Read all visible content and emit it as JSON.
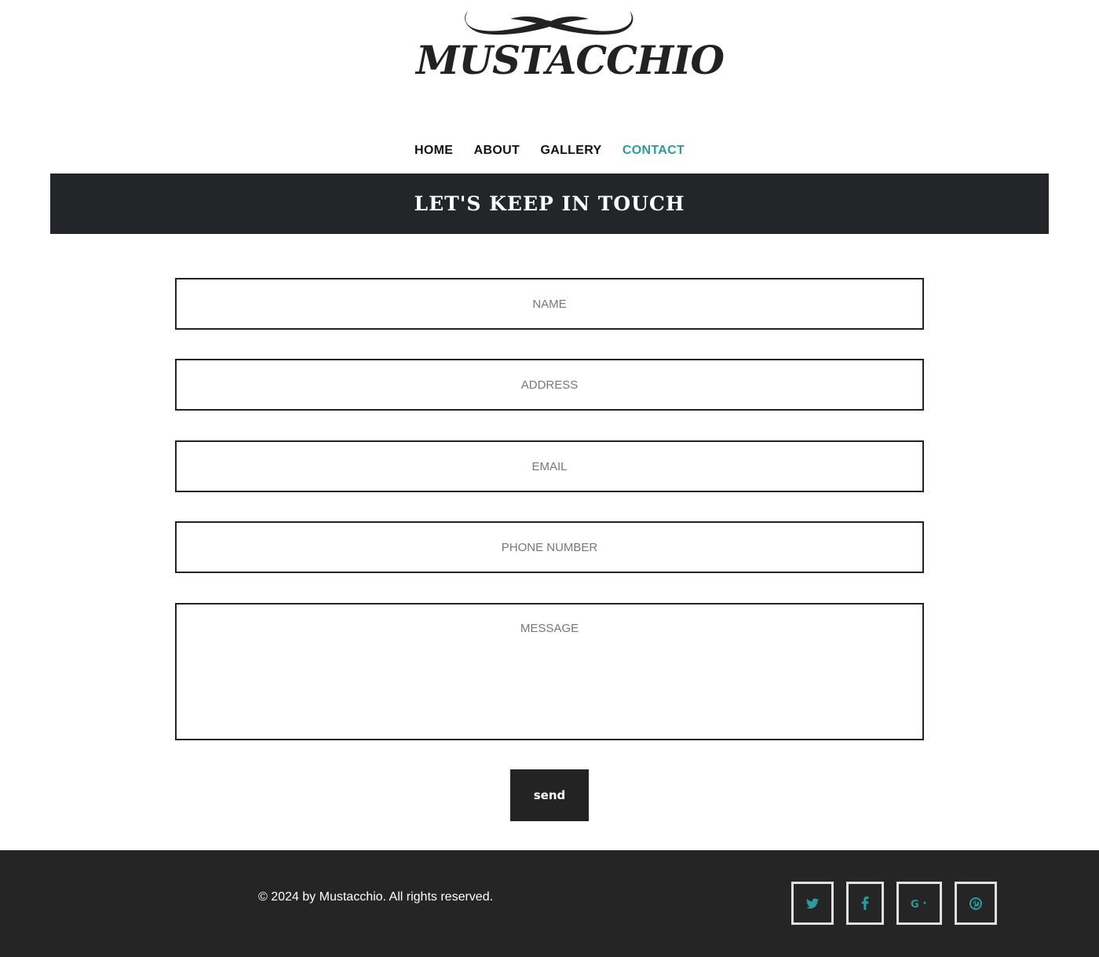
{
  "logo": {
    "text": "MUSTACCHIO"
  },
  "nav": {
    "items": [
      {
        "label": "HOME"
      },
      {
        "label": "ABOUT"
      },
      {
        "label": "GALLERY"
      },
      {
        "label": "CONTACT"
      }
    ],
    "active": "CONTACT"
  },
  "banner": {
    "title": "LET'S KEEP IN TOUCH"
  },
  "form": {
    "name_placeholder": "NAME",
    "address_placeholder": "ADDRESS",
    "email_placeholder": "EMAIL",
    "phone_placeholder": "PHONE NUMBER",
    "message_placeholder": "MESSAGE",
    "send_label": "send"
  },
  "footer": {
    "copyright": "© 2024 by Mustacchio. All rights reserved.",
    "social": [
      "twitter-icon",
      "facebook-icon",
      "google-plus-icon",
      "pinterest-icon"
    ]
  },
  "colors": {
    "accent": "#2a9d9a",
    "dark": "#232529",
    "footer": "#252525"
  }
}
